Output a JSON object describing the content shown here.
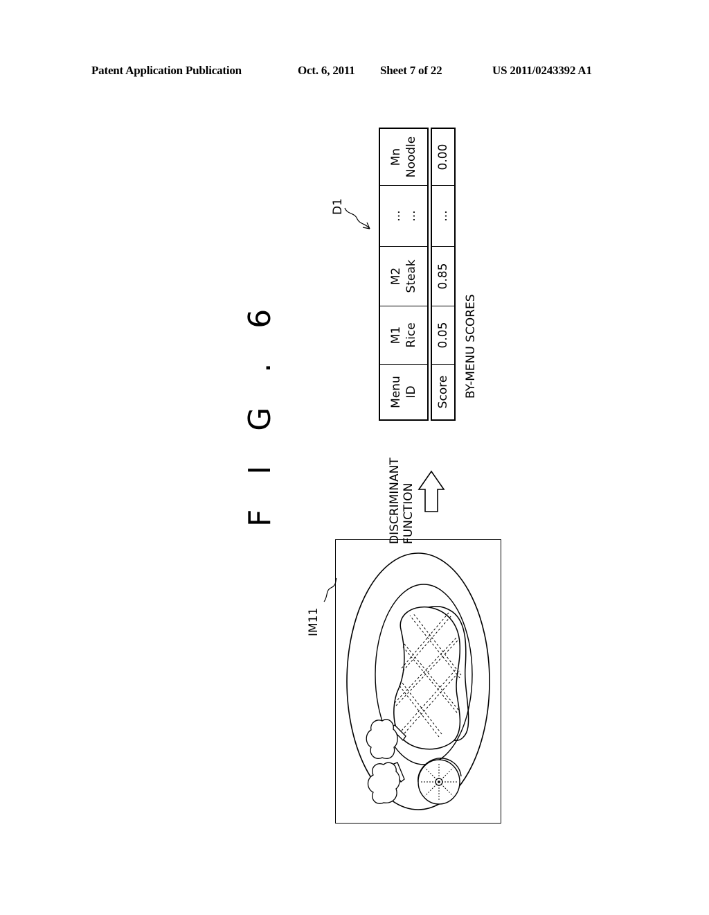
{
  "header": {
    "publication": "Patent Application Publication",
    "date": "Oct. 6, 2011",
    "sheet": "Sheet 7 of 22",
    "number": "US 2011/0243392 A1"
  },
  "figure": {
    "title": "F I G . 6",
    "image_label": "IM11",
    "arrow_label_line1": "DISCRIMINANT",
    "arrow_label_line2": "FUNCTION",
    "table_ref": "D1",
    "caption": "BY-MENU SCORES",
    "table": {
      "header_row": [
        {
          "line1": "Menu",
          "line2": "ID"
        },
        {
          "line1": "M1",
          "line2": "Rice"
        },
        {
          "line1": "M2",
          "line2": "Steak"
        },
        {
          "line1": "...",
          "line2": "..."
        },
        {
          "line1": "Mn",
          "line2": "Noodle"
        }
      ],
      "score_row": [
        "Score",
        "0.05",
        "0.85",
        "...",
        "0.00"
      ]
    },
    "illustration": {
      "subject": "plate with steak, broccoli and orange slice",
      "icons": [
        "plate-icon",
        "steak-icon",
        "broccoli-icon",
        "orange-slice-icon"
      ]
    }
  }
}
